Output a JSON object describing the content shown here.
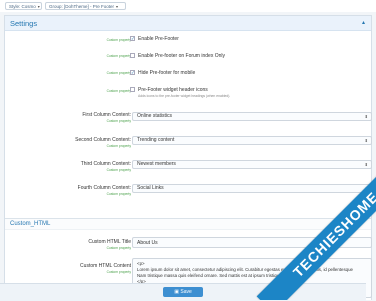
{
  "breadcrumbs": [
    "Style: Cosmo",
    "Group: [DohTheme] - Pre Footer"
  ],
  "panel": {
    "title": "Settings"
  },
  "hint_text": "Custom property",
  "checkboxes": [
    {
      "label": "Enable Pre-Footer",
      "checked": true
    },
    {
      "label": "Enable Pre-footer on Forum index Only",
      "checked": false
    },
    {
      "label": "Hide Pre-footer for mobile",
      "checked": true
    },
    {
      "label": "Pre-Footer widget header icons",
      "checked": false,
      "description": "Adds icons to the pre-footer widget headings (when enabled)."
    }
  ],
  "columns": [
    {
      "label": "First Column Content:",
      "value": "Online statistics"
    },
    {
      "label": "Second Column Content:",
      "value": "Trending content"
    },
    {
      "label": "Third Column Content:",
      "value": "Newest members"
    },
    {
      "label": "Fourth Column Content:",
      "value": "Social Links"
    }
  ],
  "custom_html": {
    "section_title": "Custom_HTML",
    "title_label": "Custom HTML Title",
    "title_value": "About Us",
    "content_label": "Custom HTML Content",
    "content_lines": [
      "<p>",
      "Lorem ipsum dolor sit amet, consectetur adipiscing elit. Curabitur egestas ex id lectus convallis, id pellentesque",
      "Nam tristique massa quis eleifend ornare. Sed mattis est at ipsum tristique egestas.",
      "</p>"
    ]
  },
  "save_label": "Save",
  "watermark": "TECHIESHOME.COM",
  "colors": {
    "accent": "#2577b1",
    "header_bg": "#eaf2fb",
    "ribbon": "#1c85c6",
    "hint": "#4aa04a"
  }
}
